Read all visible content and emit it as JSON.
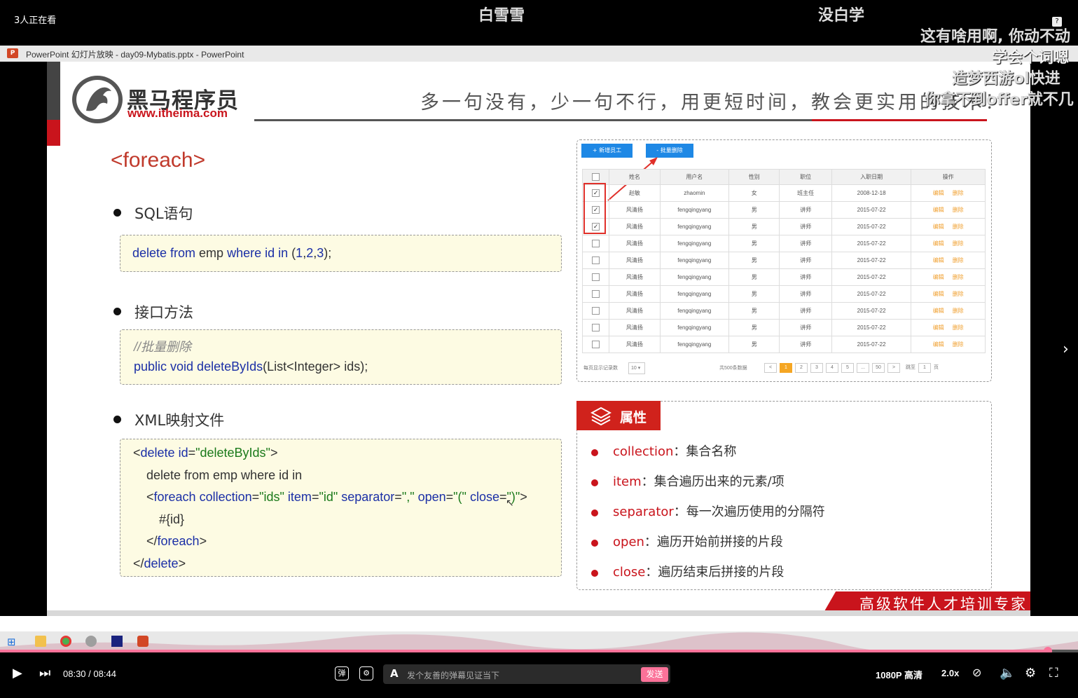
{
  "overlay": {
    "viewers": "3人正在看",
    "danmaku": [
      "白雪雪",
      "没白学",
      "这有啥用啊, 你动不动",
      "学会个词嗯",
      "造梦西游ol快进",
      "你拿不到offer就不几"
    ],
    "help": "?"
  },
  "ppt_window": {
    "title": "PowerPoint 幻灯片放映  -  day09-Mybatis.pptx  -  PowerPoint",
    "logo": "P"
  },
  "slide": {
    "brand_cn": "黑马程序员",
    "brand_url": "www.itheima.com",
    "slogan": "多一句没有，少一句不行，用更短时间，教会更实用的技术！",
    "title": "<foreach>",
    "sections": {
      "sql_label": "SQL语句",
      "sql_code": {
        "kw1": "delete from",
        "t1": " emp ",
        "kw2": "where",
        "t2": " ",
        "kw3": "id",
        "t3": " ",
        "kw4": "in",
        "t4": " (",
        "n1": "1",
        "c1": ",",
        "n2": "2",
        "c2": ",",
        "n3": "3",
        "t5": ");"
      },
      "interface_label": "接口方法",
      "interface_comment": "//批量删除",
      "interface_code": {
        "kw": "public void deleteByIds",
        "rest": "(List<Integer>  ids);"
      },
      "xml_label": "XML映射文件",
      "xml_lines": {
        "l1_a": "<",
        "l1_tag": "delete",
        "l1_attr": " id",
        "l1_eq": "=",
        "l1_val": "\"deleteByIds\"",
        "l1_end": ">",
        "l2": "delete from emp where id in",
        "l3_a": "<",
        "l3_tag": "foreach",
        "l3_at1": " collection",
        "l3_eq1": "=",
        "l3_v1": "\"ids\"",
        "l3_at2": " item",
        "l3_eq2": "=",
        "l3_v2": "\"id\"",
        "l3_at3": " separator",
        "l3_eq3": "=",
        "l3_v3": "\",\"",
        "l3_at4": " open",
        "l3_eq4": "=",
        "l3_v4": "\"(\"",
        "l3_at5": " close",
        "l3_eq5": "=",
        "l3_v5": "\")\"",
        "l3_end": ">",
        "l4": "#{id}",
        "l5_a": "</",
        "l5_tag": "foreach",
        "l5_end": ">",
        "l6_a": "</",
        "l6_tag": "delete",
        "l6_end": ">"
      }
    },
    "table_shot": {
      "btn_add": "+ 新增员工",
      "btn_delete": "- 批量删除",
      "headers": [
        "",
        "姓名",
        "用户名",
        "性别",
        "职位",
        "入职日期",
        "操作"
      ],
      "rows": [
        {
          "checked": true,
          "name": "赵敏",
          "user": "zhaomin",
          "gender": "女",
          "job": "班主任",
          "date": "2008-12-18"
        },
        {
          "checked": true,
          "name": "风清扬",
          "user": "fengqingyang",
          "gender": "男",
          "job": "讲师",
          "date": "2015-07-22"
        },
        {
          "checked": true,
          "name": "风清扬",
          "user": "fengqingyang",
          "gender": "男",
          "job": "讲师",
          "date": "2015-07-22"
        },
        {
          "checked": false,
          "name": "风清扬",
          "user": "fengqingyang",
          "gender": "男",
          "job": "讲师",
          "date": "2015-07-22"
        },
        {
          "checked": false,
          "name": "风清扬",
          "user": "fengqingyang",
          "gender": "男",
          "job": "讲师",
          "date": "2015-07-22"
        },
        {
          "checked": false,
          "name": "风清扬",
          "user": "fengqingyang",
          "gender": "男",
          "job": "讲师",
          "date": "2015-07-22"
        },
        {
          "checked": false,
          "name": "风清扬",
          "user": "fengqingyang",
          "gender": "男",
          "job": "讲师",
          "date": "2015-07-22"
        },
        {
          "checked": false,
          "name": "风清扬",
          "user": "fengqingyang",
          "gender": "男",
          "job": "讲师",
          "date": "2015-07-22"
        },
        {
          "checked": false,
          "name": "风清扬",
          "user": "fengqingyang",
          "gender": "男",
          "job": "讲师",
          "date": "2015-07-22"
        },
        {
          "checked": false,
          "name": "风清扬",
          "user": "fengqingyang",
          "gender": "男",
          "job": "讲师",
          "date": "2015-07-22"
        }
      ],
      "action_edit": "编辑",
      "action_delete": "删除",
      "pager": {
        "per_page_label": "每页显示记录数",
        "per_page": "10",
        "total": "共500条数据",
        "prev": "<",
        "pages": [
          "1",
          "2",
          "3",
          "4",
          "5",
          "...",
          "50"
        ],
        "next": ">",
        "goto_label": "跳至",
        "goto_value": "1",
        "page_unit": "页"
      }
    },
    "attributes": {
      "title": "属性",
      "items": [
        {
          "key": "collection",
          "desc": "：集合名称"
        },
        {
          "key": "item",
          "desc": "：集合遍历出来的元素/项"
        },
        {
          "key": "separator",
          "desc": "：每一次遍历使用的分隔符"
        },
        {
          "key": "open",
          "desc": "：遍历开始前拼接的片段"
        },
        {
          "key": "close",
          "desc": "：遍历结束后拼接的片段"
        }
      ]
    },
    "banner": "高级软件人才培训专家"
  },
  "player": {
    "time_current": "08:30",
    "time_sep": "/",
    "time_total": "08:44",
    "danmaku_placeholder": "发个友善的弹幕见证当下",
    "send": "发送",
    "quality": "1080P 高清",
    "speed": "2.0x",
    "progress_fraction": 0.972
  },
  "colors": {
    "accent": "#fb7299",
    "brand_red": "#c9141c",
    "code_keyword": "#1b2fa6",
    "code_string": "#1b7a1b"
  }
}
